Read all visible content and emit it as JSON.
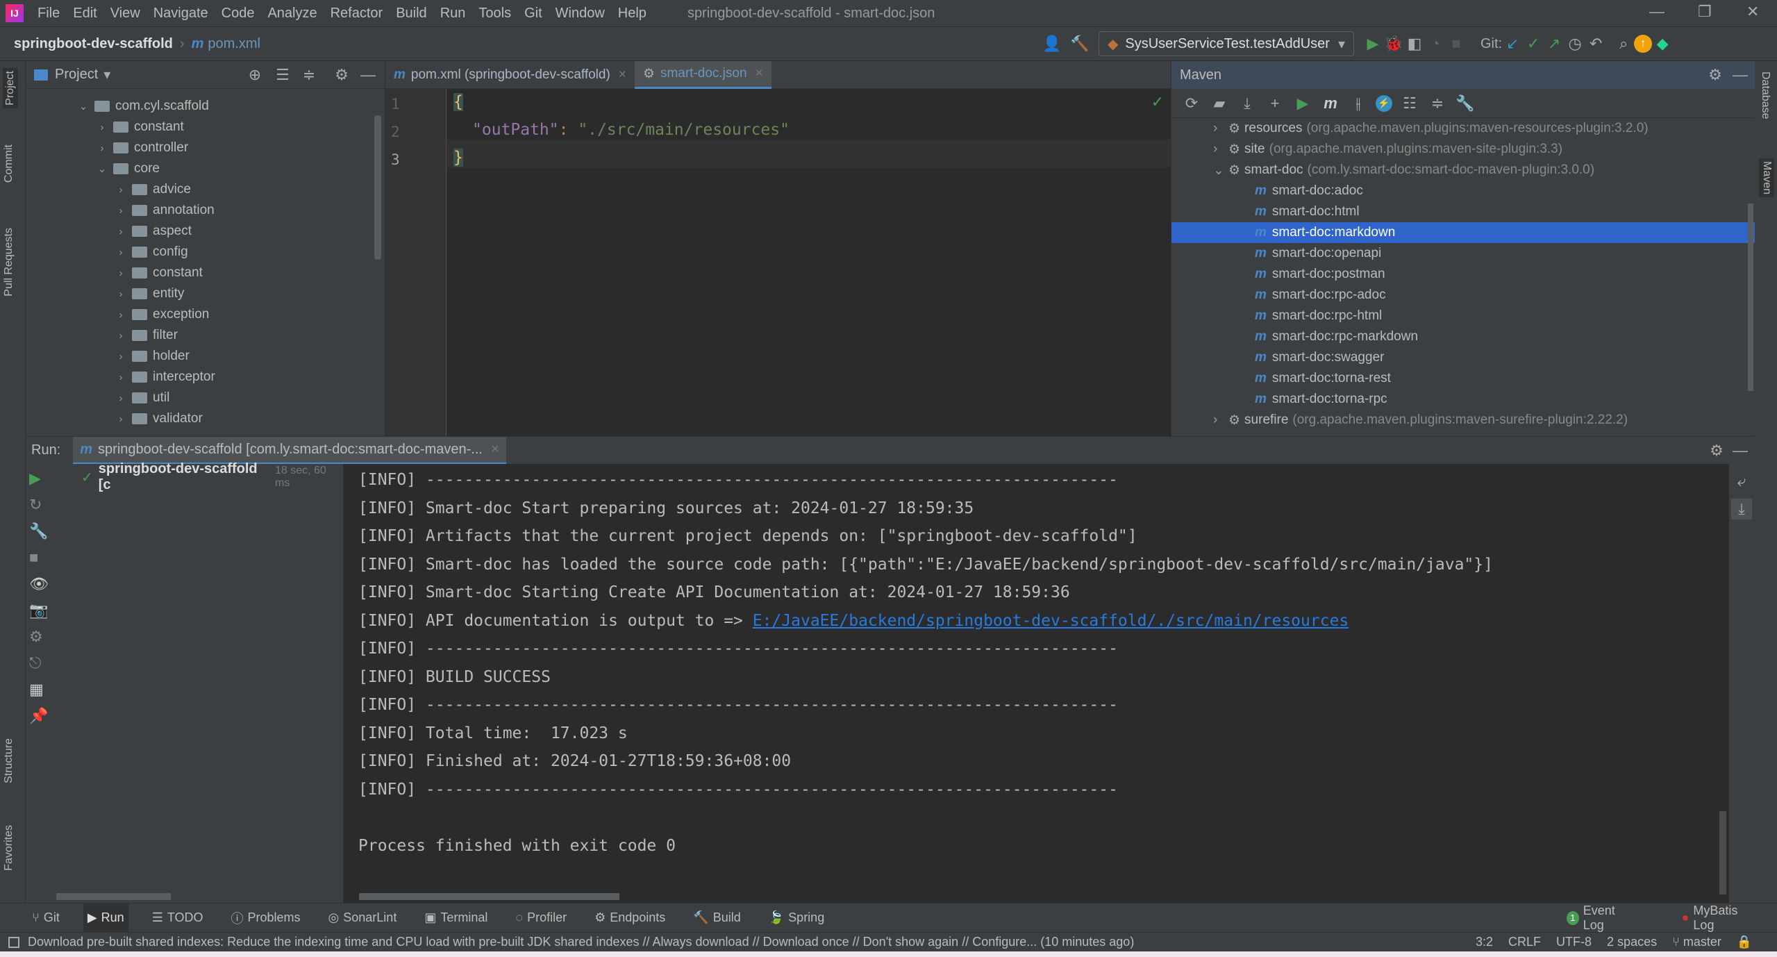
{
  "menu": {
    "items": [
      "File",
      "Edit",
      "View",
      "Navigate",
      "Code",
      "Analyze",
      "Refactor",
      "Build",
      "Run",
      "Tools",
      "Git",
      "Window",
      "Help"
    ],
    "title": "springboot-dev-scaffold - smart-doc.json"
  },
  "nav": {
    "project": "springboot-dev-scaffold",
    "file": "pom.xml",
    "run_config": "SysUserServiceTest.testAddUser",
    "git_label": "Git:"
  },
  "left_stripe": [
    "Project",
    "Commit",
    "Pull Requests",
    "Structure",
    "Favorites"
  ],
  "right_stripe": [
    "Database",
    "Maven"
  ],
  "project": {
    "title": "Project",
    "tree": [
      {
        "label": "com.cyl.scaffold",
        "level": 0,
        "open": true
      },
      {
        "label": "constant",
        "level": 1
      },
      {
        "label": "controller",
        "level": 1
      },
      {
        "label": "core",
        "level": 1,
        "open": true
      },
      {
        "label": "advice",
        "level": 2
      },
      {
        "label": "annotation",
        "level": 2
      },
      {
        "label": "aspect",
        "level": 2
      },
      {
        "label": "config",
        "level": 2
      },
      {
        "label": "constant",
        "level": 2
      },
      {
        "label": "entity",
        "level": 2
      },
      {
        "label": "exception",
        "level": 2
      },
      {
        "label": "filter",
        "level": 2
      },
      {
        "label": "holder",
        "level": 2
      },
      {
        "label": "interceptor",
        "level": 2
      },
      {
        "label": "util",
        "level": 2
      },
      {
        "label": "validator",
        "level": 2
      }
    ]
  },
  "editor": {
    "tabs": [
      {
        "label": "pom.xml (springboot-dev-scaffold)"
      },
      {
        "label": "smart-doc.json",
        "active": true
      }
    ],
    "lines": [
      "1",
      "2",
      "3"
    ],
    "open_brace": "{",
    "key": "\"outPath\"",
    "colon": ": ",
    "value": "\"./src/main/resources\"",
    "close_brace": "}"
  },
  "maven": {
    "title": "Maven",
    "plugins": [
      {
        "name": "resources",
        "coord": "(org.apache.maven.plugins:maven-resources-plugin:3.2.0)"
      },
      {
        "name": "site",
        "coord": "(org.apache.maven.plugins:maven-site-plugin:3.3)"
      },
      {
        "name": "smart-doc",
        "coord": "(com.ly.smart-doc:smart-doc-maven-plugin:3.0.0)"
      }
    ],
    "goals": [
      "smart-doc:adoc",
      "smart-doc:html",
      "smart-doc:markdown",
      "smart-doc:openapi",
      "smart-doc:postman",
      "smart-doc:rpc-adoc",
      "smart-doc:rpc-html",
      "smart-doc:rpc-markdown",
      "smart-doc:swagger",
      "smart-doc:torna-rest",
      "smart-doc:torna-rpc"
    ],
    "selected_goal": "smart-doc:markdown",
    "last_plugin": {
      "name": "surefire",
      "coord": "(org.apache.maven.plugins:maven-surefire-plugin:2.22.2)"
    }
  },
  "run": {
    "label": "Run:",
    "tab": "springboot-dev-scaffold [com.ly.smart-doc:smart-doc-maven-...",
    "tree_item": "springboot-dev-scaffold [c",
    "tree_time": "18 sec, 60 ms",
    "console": [
      "[INFO] ------------------------------------------------------------------------",
      "[INFO] Smart-doc Start preparing sources at: 2024-01-27 18:59:35",
      "[INFO] Artifacts that the current project depends on: [\"springboot-dev-scaffold\"]",
      "[INFO] Smart-doc has loaded the source code path: [{\"path\":\"E:/JavaEE/backend/springboot-dev-scaffold/src/main/java\"}]",
      "[INFO] Smart-doc Starting Create API Documentation at: 2024-01-27 18:59:36",
      "[INFO] API documentation is output to => ",
      "[INFO] ------------------------------------------------------------------------",
      "[INFO] BUILD SUCCESS",
      "[INFO] ------------------------------------------------------------------------",
      "[INFO] Total time:  17.023 s",
      "[INFO] Finished at: 2024-01-27T18:59:36+08:00",
      "[INFO] ------------------------------------------------------------------------",
      "",
      "Process finished with exit code 0"
    ],
    "output_link": "E:/JavaEE/backend/springboot-dev-scaffold/./src/main/resources"
  },
  "toolwindows": [
    "Git",
    "Run",
    "TODO",
    "Problems",
    "SonarLint",
    "Terminal",
    "Profiler",
    "Endpoints",
    "Build",
    "Spring"
  ],
  "toolwindows_right": {
    "event_log": "Event Log",
    "event_count": "1",
    "mybatis": "MyBatis Log"
  },
  "status": {
    "message": "Download pre-built shared indexes: Reduce the indexing time and CPU load with pre-built JDK shared indexes // Always download // Download once // Don't show again // Configure... (10 minutes ago)",
    "position": "3:2",
    "line_sep": "CRLF",
    "encoding": "UTF-8",
    "indent": "2 spaces",
    "branch": "master"
  },
  "colors": {
    "accent": "#4a88c7",
    "selection": "#2f65ca",
    "green": "#499c54",
    "link": "#287bde"
  }
}
